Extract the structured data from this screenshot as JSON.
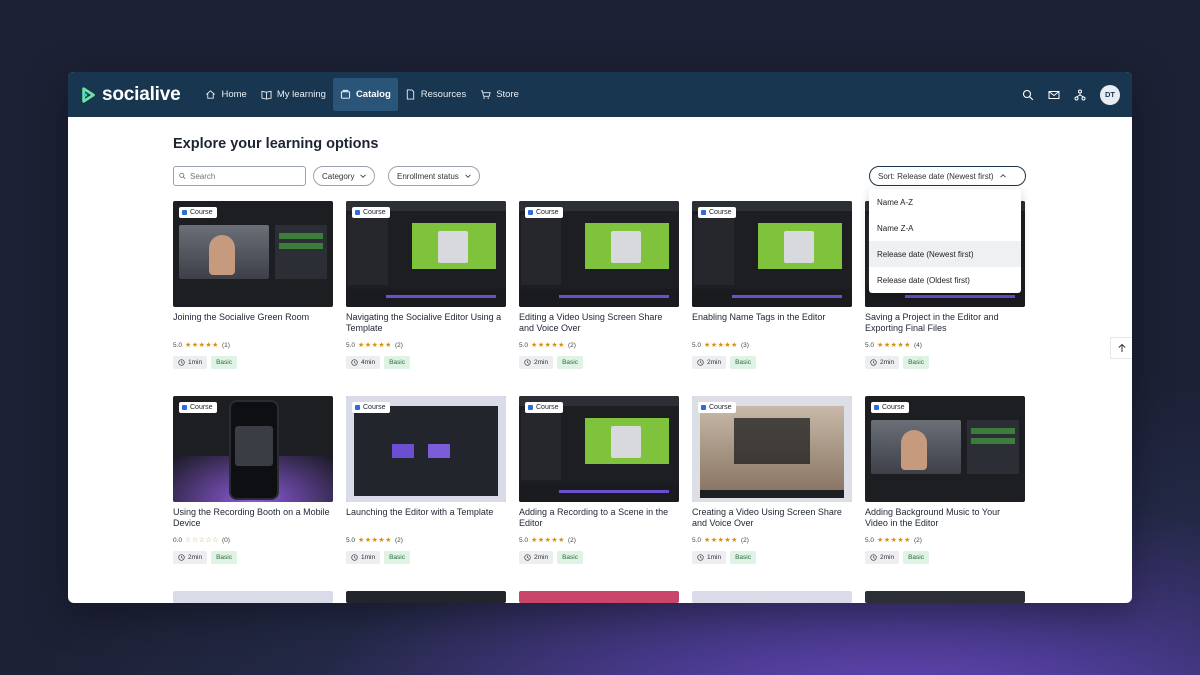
{
  "app": {
    "brand": "socialive"
  },
  "nav": {
    "items": [
      {
        "label": "Home",
        "icon": "home-icon",
        "active": false
      },
      {
        "label": "My learning",
        "icon": "book-icon",
        "active": false
      },
      {
        "label": "Catalog",
        "icon": "catalog-icon",
        "active": true
      },
      {
        "label": "Resources",
        "icon": "document-icon",
        "active": false
      },
      {
        "label": "Store",
        "icon": "cart-icon",
        "active": false
      }
    ],
    "right_icons": [
      "search-icon",
      "mail-icon",
      "org-chart-icon"
    ],
    "avatar_initials": "DT"
  },
  "page": {
    "title": "Explore your learning options",
    "search_placeholder": "Search",
    "filters": {
      "category": "Category",
      "enrollment": "Enrollment status"
    },
    "sort": {
      "label": "Sort: Release date (Newest first)",
      "options": [
        "Name A-Z",
        "Name Z-A",
        "Release date (Newest first)",
        "Release date (Oldest first)"
      ],
      "selected_index": 2
    }
  },
  "badge_label": "Course",
  "courses": [
    {
      "title": "Joining the Socialive Green Room",
      "rating": "5.0",
      "count": "(1)",
      "stars": 5,
      "duration": "1min",
      "level": "Basic",
      "theme": "dark-person"
    },
    {
      "title": "Navigating the Socialive Editor Using a Template",
      "rating": "5.0",
      "count": "(2)",
      "stars": 5,
      "duration": "4min",
      "level": "Basic",
      "theme": "editor-green"
    },
    {
      "title": "Editing a Video Using Screen Share and Voice Over",
      "rating": "5.0",
      "count": "(2)",
      "stars": 5,
      "duration": "2min",
      "level": "Basic",
      "theme": "editor-green"
    },
    {
      "title": "Enabling Name Tags in the Editor",
      "rating": "5.0",
      "count": "(3)",
      "stars": 5,
      "duration": "2min",
      "level": "Basic",
      "theme": "editor-green"
    },
    {
      "title": "Saving a Project in the Editor and Exporting Final Files",
      "rating": "5.0",
      "count": "(4)",
      "stars": 5,
      "duration": "2min",
      "level": "Basic",
      "theme": "editor-green"
    },
    {
      "title": "Using the Recording Booth on a Mobile Device",
      "rating": "0.0",
      "count": "(0)",
      "stars": 0,
      "duration": "2min",
      "level": "Basic",
      "theme": "mobile"
    },
    {
      "title": "Launching the Editor with a Template",
      "rating": "5.0",
      "count": "(2)",
      "stars": 5,
      "duration": "1min",
      "level": "Basic",
      "theme": "dark-ui"
    },
    {
      "title": "Adding a Recording to a Scene in the Editor",
      "rating": "5.0",
      "count": "(2)",
      "stars": 5,
      "duration": "2min",
      "level": "Basic",
      "theme": "editor-green"
    },
    {
      "title": "Creating a Video Using Screen Share and Voice Over",
      "rating": "5.0",
      "count": "(2)",
      "stars": 5,
      "duration": "1min",
      "level": "Basic",
      "theme": "room"
    },
    {
      "title": "Adding Background Music to Your Video in the Editor",
      "rating": "5.0",
      "count": "(2)",
      "stars": 5,
      "duration": "2min",
      "level": "Basic",
      "theme": "dark-person"
    }
  ]
}
